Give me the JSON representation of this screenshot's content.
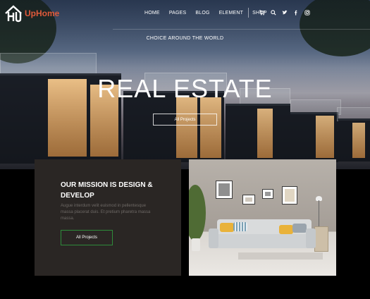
{
  "brand": {
    "name": "UpHome",
    "logo_icon": "house-logo-icon",
    "accent": "#e05a3a"
  },
  "nav": {
    "items": [
      "HOME",
      "PAGES",
      "BLOG",
      "ELEMENT",
      "SHOP"
    ],
    "icons": [
      {
        "name": "cart-icon",
        "glyph": "🛒"
      },
      {
        "name": "search-icon",
        "glyph": "⌕"
      },
      {
        "name": "twitter-icon",
        "glyph": "🐦"
      },
      {
        "name": "facebook-icon",
        "glyph": "f"
      },
      {
        "name": "instagram-icon",
        "glyph": "◎"
      }
    ]
  },
  "hero": {
    "tagline": "CHOICE AROUND THE WORLD",
    "title": "REAL ESTATE",
    "button_label": "All Projects"
  },
  "mission": {
    "title": "OUR MISSION IS DESIGN & DEVELOP",
    "body": "Augue interdum velit euismod in pellentesque massa placerat duis. Et pretium pharetra massa massa.",
    "button_label": "All Projects",
    "button_border": "#2e8b3a"
  }
}
